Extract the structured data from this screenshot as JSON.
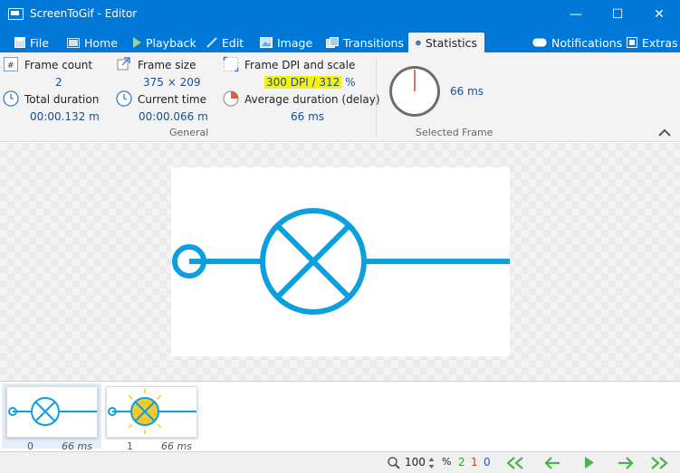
{
  "window": {
    "title": "ScreenToGif - Editor",
    "controls": {
      "minimize": "—",
      "maximize": "☐",
      "close": "✕"
    }
  },
  "tabs": [
    {
      "label": "File",
      "icon": "save-icon"
    },
    {
      "label": "Home",
      "icon": "home-icon"
    },
    {
      "label": "Playback",
      "icon": "play-icon"
    },
    {
      "label": "Edit",
      "icon": "pencil-icon"
    },
    {
      "label": "Image",
      "icon": "image-icon"
    },
    {
      "label": "Transitions",
      "icon": "transitions-icon"
    },
    {
      "label": "Statistics",
      "icon": "info-icon",
      "active": true
    }
  ],
  "right_tabs": [
    {
      "label": "Notifications",
      "icon": "notification-icon"
    },
    {
      "label": "Extras",
      "icon": "extras-icon"
    }
  ],
  "statistics": {
    "frame_count": {
      "label": "Frame count",
      "value": "2"
    },
    "total_duration": {
      "label": "Total duration",
      "value": "00:00.132 m"
    },
    "frame_size": {
      "label": "Frame size",
      "value": "375 × 209"
    },
    "current_time": {
      "label": "Current time",
      "value": "00:00.066 m"
    },
    "frame_dpi": {
      "label": "Frame DPI and scale",
      "value": "300 DPI / 312",
      "suffix": "%"
    },
    "average_duration": {
      "label": "Average duration (delay)",
      "value": "66 ms"
    },
    "general_label": "General",
    "selected_frame": {
      "value": "66 ms",
      "label": "Selected Frame"
    }
  },
  "frames": [
    {
      "index": "0",
      "duration": "66 ms",
      "selected": true
    },
    {
      "index": "1",
      "duration": "66 ms",
      "selected": false
    }
  ],
  "statusbar": {
    "zoom": "100",
    "zoom_unit": "%",
    "count_total": "2",
    "count_selected": "1",
    "count_other": "0"
  },
  "colors": {
    "accent": "#0078d7",
    "circuit": "#0c9fe0",
    "bulb_on": "#f6c92b",
    "highlight": "#f7f307",
    "green": "#4caf50",
    "red": "#d32f2f",
    "blue_count": "#1a56d6"
  }
}
